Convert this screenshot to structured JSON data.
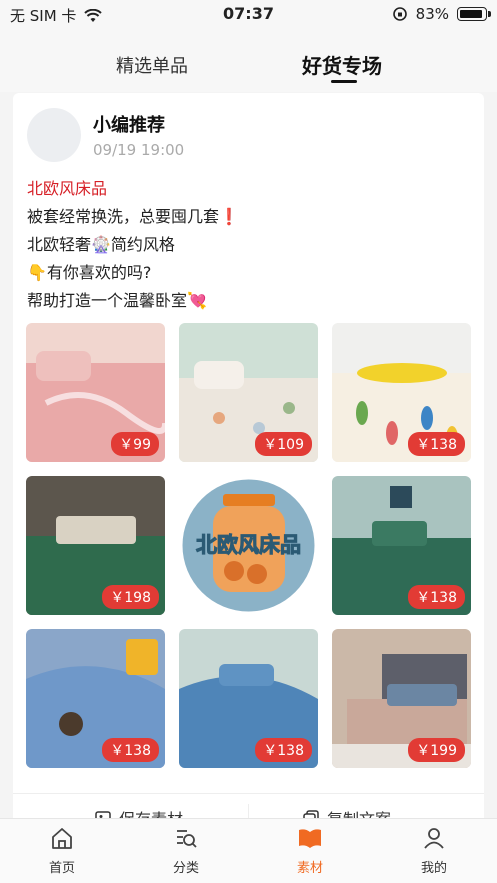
{
  "status_bar": {
    "carrier": "无 SIM 卡",
    "time": "07:37",
    "battery": "83%",
    "battery_level": 0.83
  },
  "tabs": [
    {
      "label": "精选单品",
      "active": false
    },
    {
      "label": "好货专场",
      "active": true
    }
  ],
  "post": {
    "author": "小编推荐",
    "date": "09/19 19:00",
    "lines": [
      "北欧风床品",
      "被套经常换洗，总要囤几套❗",
      "北欧轻奢🎡简约风格",
      "👇有你喜欢的吗?",
      "帮助打造一个温馨卧室💘"
    ],
    "images": [
      {
        "price": "￥99",
        "color": "#e9a9a8"
      },
      {
        "price": "￥109",
        "color": "#e6e0d9"
      },
      {
        "price": "￥138",
        "color": "#f3e9c5"
      },
      {
        "price": "￥198",
        "color": "#3b6f52"
      },
      {
        "label": "北欧风床品",
        "color": "#8bb2c7"
      },
      {
        "price": "￥138",
        "color": "#2f6b55"
      },
      {
        "price": "￥138",
        "color": "#6f98c9"
      },
      {
        "price": "￥138",
        "color": "#4f85b8"
      },
      {
        "price": "￥199",
        "color": "#6b86a3"
      }
    ],
    "actions": [
      {
        "label": "保存素材",
        "icon": "image-save-icon"
      },
      {
        "label": "复制文案",
        "icon": "copy-icon"
      }
    ]
  },
  "nav": [
    {
      "label": "首页",
      "icon": "home-icon",
      "active": false
    },
    {
      "label": "分类",
      "icon": "category-search-icon",
      "active": false
    },
    {
      "label": "素材",
      "icon": "book-icon",
      "active": true
    },
    {
      "label": "我的",
      "icon": "user-icon",
      "active": false
    }
  ],
  "colors": {
    "accent": "#f06a22",
    "price_badge": "#e23b35",
    "title_red": "#d61f26"
  }
}
